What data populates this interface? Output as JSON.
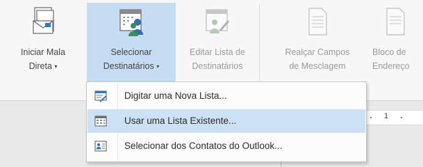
{
  "ribbon": {
    "buttons": [
      {
        "line1": "Iniciar Mala",
        "line2": "Direta",
        "icon": "start-mail-merge-icon"
      },
      {
        "line1": "Selecionar",
        "line2": "Destinatários",
        "icon": "select-recipients-icon"
      },
      {
        "line1": "Editar Lista de",
        "line2": "Destinatários",
        "icon": "edit-recipient-list-icon"
      },
      {
        "line1": "Realçar Campos",
        "line2": "de Mesclagem",
        "icon": "highlight-merge-fields-icon"
      },
      {
        "line1": "Bloco de",
        "line2": "Endereço",
        "icon": "address-block-icon"
      }
    ],
    "caret": "▾"
  },
  "menu": {
    "items": [
      {
        "label": "Digitar uma Nova Lista...",
        "icon": "type-new-list-icon"
      },
      {
        "label": "Usar uma Lista Existente...",
        "icon": "use-existing-list-icon"
      },
      {
        "label": "Selecionar dos Contatos do Outlook...",
        "icon": "outlook-contacts-icon"
      }
    ]
  },
  "ruler": {
    "number": "1"
  },
  "colors": {
    "selected": "#c5dcf2",
    "hover": "#cde1f5",
    "accent": "#2e77c5"
  }
}
